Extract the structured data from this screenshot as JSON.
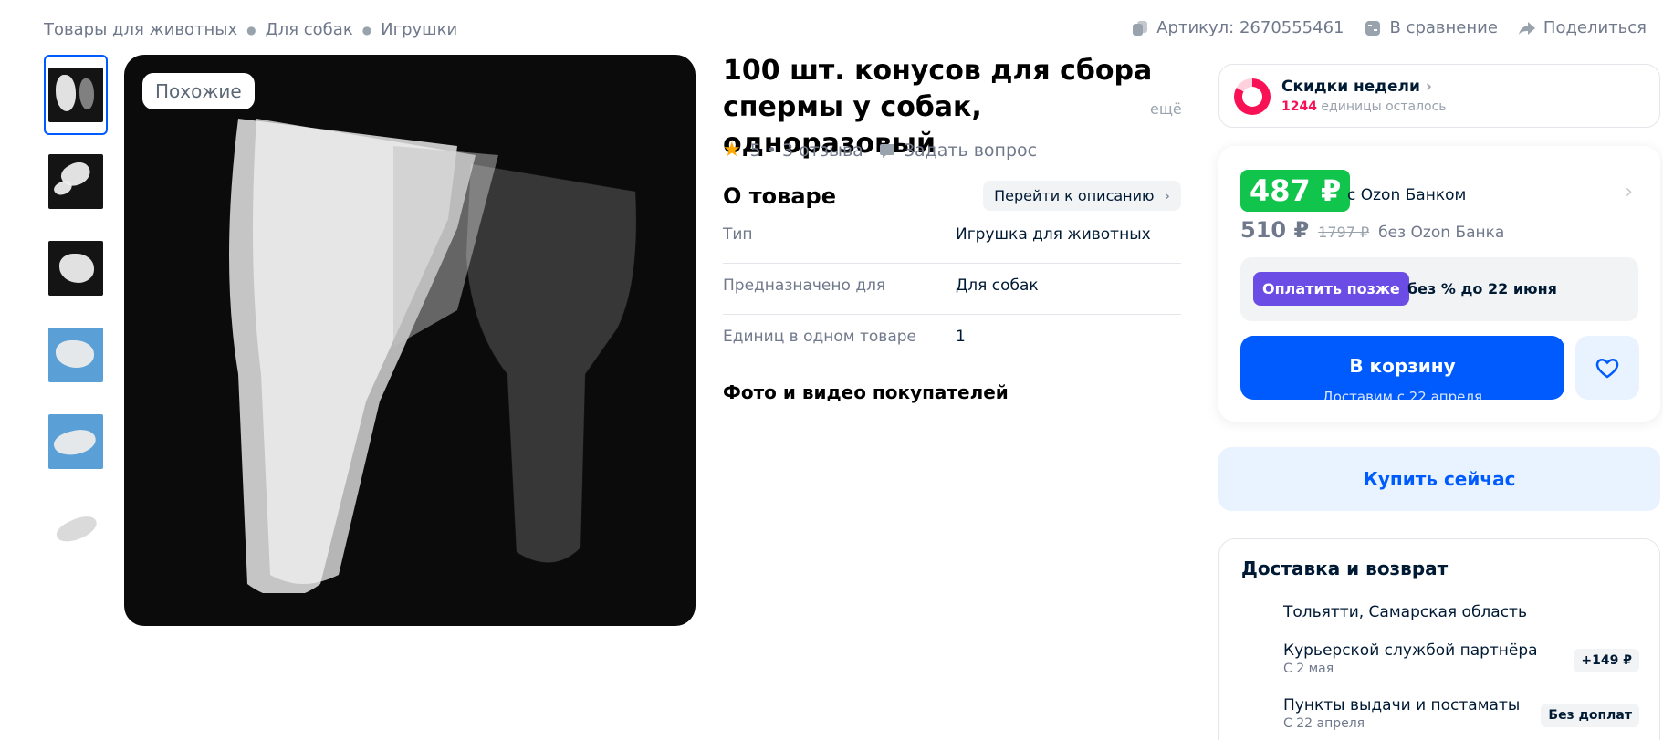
{
  "breadcrumbs": [
    "Товары для животных",
    "Для собак",
    "Игрушки"
  ],
  "top_actions": {
    "article": "Артикул: 2670555461",
    "compare": "В сравнение",
    "share": "Поделиться"
  },
  "gallery": {
    "similar_badge": "Похожие",
    "thumbnail_count": 6
  },
  "product": {
    "title": "100 шт. конусов для сбора спермы у собак, одноразовый",
    "more": "ещё",
    "rating": "5",
    "reviews": "3 отзыва",
    "ask_question": "Задать вопрос"
  },
  "about": {
    "heading": "О товаре",
    "goto_description": "Перейти к описанию",
    "specs": [
      {
        "key": "Тип",
        "value": "Игрушка для животных"
      },
      {
        "key": "Предназначено для",
        "value": "Для собак"
      },
      {
        "key": "Единиц в одном товаре",
        "value": "1"
      }
    ],
    "photos_heading": "Фото и видео покупателей"
  },
  "discount": {
    "title": "Скидки недели",
    "remaining_count": "1244",
    "remaining_text": "единицы осталось"
  },
  "price": {
    "bank_price": "487 ₽",
    "bank_label": "с Ozon Банком",
    "regular_price": "510 ₽",
    "old_price": "1797 ₽",
    "regular_label": "без Ozon Банка",
    "pay_later_button": "Оплатить позже",
    "pay_later_text": "без % до 22 июня",
    "cart_button": "В корзину",
    "cart_subtext": "Доставим с 22 апреля",
    "buy_now": "Купить сейчас"
  },
  "delivery": {
    "heading": "Доставка и возврат",
    "city": "Тольятти, Самарская область",
    "options": [
      {
        "name": "Курьерской службой партнёра",
        "date": "С 2 мая",
        "tag": "+149 ₽"
      },
      {
        "name": "Пункты выдачи и постаматы",
        "date": "С 22 апреля",
        "tag": "Без доплат"
      }
    ]
  },
  "colors": {
    "accent_blue": "#005bff",
    "bank_green": "#10c44c",
    "pay_later_purple": "#6b4de6",
    "discount_pink": "#f91155",
    "rating_star": "#ffa800"
  }
}
